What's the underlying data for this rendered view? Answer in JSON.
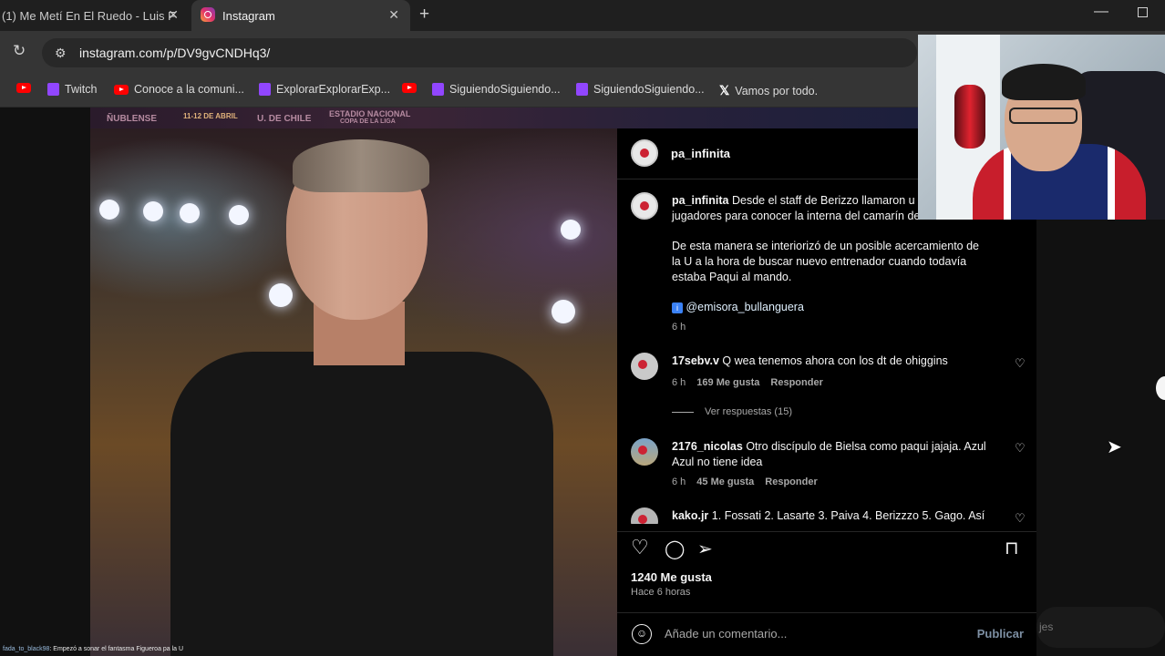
{
  "browser": {
    "tabs": [
      {
        "title": "(1) Me Metí En El Ruedo - Luis F",
        "active": false
      },
      {
        "title": "Instagram",
        "active": true
      }
    ],
    "url": "instagram.com/p/DV9gvCNDHq3/"
  },
  "bookmarks": [
    {
      "label": "Twitch",
      "icon": "twitch-icon"
    },
    {
      "label": "Conoce a la comuni...",
      "icon": "youtube-icon"
    },
    {
      "label": "ExplorarExplorarExp...",
      "icon": "twitch-icon"
    },
    {
      "label": "SiguiendoSiguiendo...",
      "icon": "twitch-icon"
    },
    {
      "label": "SiguiendoSiguiendo...",
      "icon": "twitch-icon"
    },
    {
      "label": "Vamos por todo.",
      "icon": "x-icon"
    }
  ],
  "banner": {
    "left": "ÑUBLENSE",
    "date": "11-12 DE ABRIL",
    "team": "U. DE CHILE",
    "stadium": "ESTADIO NACIONAL",
    "cup": "COPA DE LA LIGA"
  },
  "post": {
    "username": "pa_infinita",
    "caption_user": "pa_infinita",
    "caption_line1": "Desde el staff de Berizzo llamaron u",
    "caption_line2": "jugadores para conocer la interna del camarín de la U",
    "caption_p2": "De esta manera se interiorizó de un posible acercamiento de la U a la hora de buscar nuevo entrenador cuando todavía estaba Paqui al mando.",
    "caption_mention": "@emisora_bullanguera",
    "caption_time": "6 h",
    "likes": "1240 Me gusta",
    "ago": "Hace 6 horas"
  },
  "comments": [
    {
      "user": "17sebv.v",
      "text": "Q wea tenemos ahora con los dt de ohiggins",
      "time": "6 h",
      "likes": "169 Me gusta",
      "reply": "Responder",
      "view_replies": "Ver respuestas (15)"
    },
    {
      "user": "2176_nicolas",
      "text": "Otro discípulo de Bielsa como paqui jajaja. Azul Azul no tiene idea",
      "time": "6 h",
      "likes": "45 Me gusta",
      "reply": "Responder"
    },
    {
      "user": "kako.jr",
      "text": "1. Fossati 2. Lasarte 3. Paiva 4. Berizzzo 5. Gago. Así"
    }
  ],
  "comment_box": {
    "placeholder": "Añade un comentario...",
    "publish": "Publicar"
  },
  "chat": {
    "user": "fada_to_black98",
    "message": ": Empezó a sonar el fantasma Figueroa pa la U"
  },
  "background_text": "jes"
}
